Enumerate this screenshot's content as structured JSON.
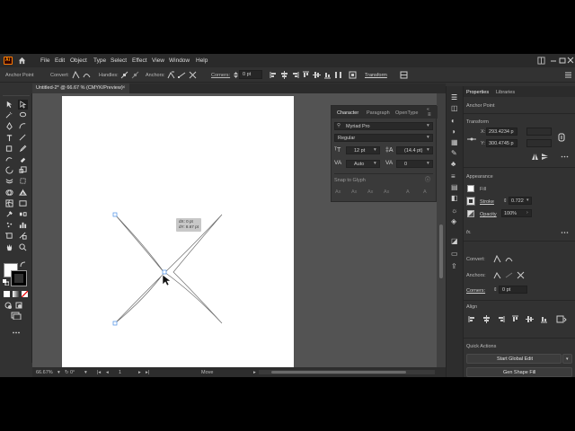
{
  "menu": {
    "logo": "Ai",
    "items": [
      "File",
      "Edit",
      "Object",
      "Type",
      "Select",
      "Effect",
      "View",
      "Window",
      "Help"
    ]
  },
  "control_bar": {
    "tool_name": "Anchor Point",
    "convert_label": "Convert:",
    "handles_label": "Handles:",
    "anchors_label": "Anchors:",
    "corners_label": "Corners:",
    "corners_value": "0 pt",
    "transform_label": "Transform"
  },
  "document": {
    "tab_title": "Untitled-2* @ 66.67 % (CMYK/Preview)"
  },
  "status_bar": {
    "zoom": "66.67%",
    "rotation": "0°",
    "artboard": "1",
    "tool": "Move"
  },
  "canvas": {
    "tooltip_dx": "dX: 0 pt",
    "tooltip_dy": "dY: 8.67 pt"
  },
  "character_panel": {
    "tabs": [
      "Character",
      "Paragraph",
      "OpenType"
    ],
    "font_family": "Myriad Pro",
    "font_style": "Regular",
    "font_size": "12 pt",
    "leading": "(14.4 pt)",
    "kerning": "Auto",
    "tracking": "0",
    "snap_to_glyph": "Snap to Glyph"
  },
  "properties_panel": {
    "tabs": [
      "Properties",
      "Libraries"
    ],
    "selection_type": "Anchor Point",
    "transform_header": "Transform",
    "x_label": "X:",
    "x_value": "293.4234 p",
    "y_label": "Y:",
    "y_value": "300.4745 p",
    "appearance_header": "Appearance",
    "fill_label": "Fill",
    "stroke_label": "Stroke",
    "stroke_value": "0.722",
    "opacity_label": "Opacity",
    "opacity_value": "100%",
    "fx_label": "fx.",
    "convert_label": "Convert:",
    "anchors_label": "Anchors:",
    "corners_label": "Corners:",
    "corners_value": "0 pt",
    "align_header": "Align",
    "quick_actions_header": "Quick Actions",
    "start_global_edit": "Start Global Edit",
    "gen_shape_fill": "Gen Shape Fill"
  },
  "colors": {
    "app_bg": "#323232",
    "pasteboard": "#535353",
    "artboard": "#ffffff",
    "accent": "#4a8fe7",
    "logo_bg": "#ff7c00"
  }
}
